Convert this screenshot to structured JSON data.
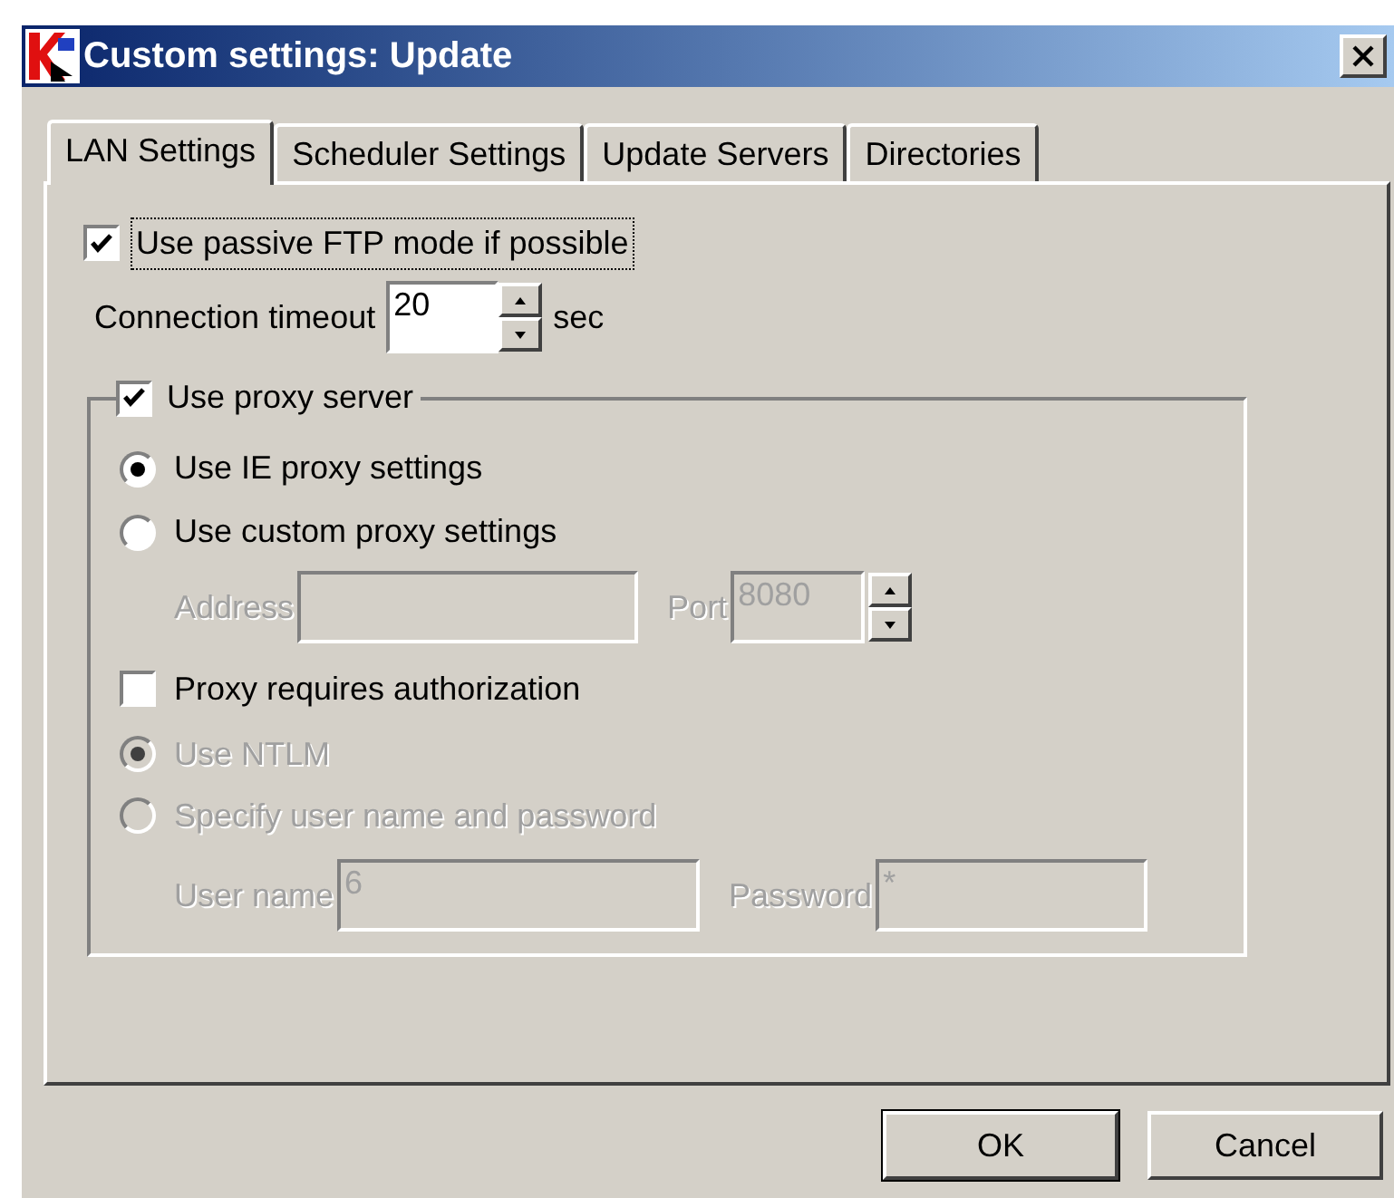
{
  "window": {
    "title": "Custom settings: Update"
  },
  "tabs": [
    {
      "label": "LAN Settings",
      "selected": true
    },
    {
      "label": "Scheduler Settings",
      "selected": false
    },
    {
      "label": "Update Servers",
      "selected": false
    },
    {
      "label": "Directories",
      "selected": false
    }
  ],
  "passive_ftp": {
    "label": "Use passive FTP mode if possible",
    "checked": true,
    "focused": true
  },
  "timeout": {
    "label": "Connection timeout",
    "value": "20",
    "unit": "sec"
  },
  "proxy": {
    "label": "Use proxy server",
    "checked": true,
    "modes": [
      {
        "label": "Use IE proxy settings",
        "selected": true,
        "disabled": false
      },
      {
        "label": "Use custom proxy settings",
        "selected": false,
        "disabled": false
      }
    ],
    "address": {
      "label": "Address",
      "disabled": true
    },
    "port": {
      "label": "Port",
      "value": "8080",
      "disabled": true
    },
    "auth": {
      "label": "Proxy requires authorization",
      "checked": false
    },
    "auth_modes": [
      {
        "label": "Use NTLM",
        "selected": true,
        "disabled": true
      },
      {
        "label": "Specify user name and password",
        "selected": false,
        "disabled": true
      }
    ],
    "username": {
      "label": "User name",
      "value": "6",
      "disabled": true
    },
    "password": {
      "label": "Password",
      "value": "*",
      "disabled": true
    }
  },
  "buttons": [
    {
      "label": "OK",
      "default": true
    },
    {
      "label": "Cancel",
      "default": false
    }
  ]
}
